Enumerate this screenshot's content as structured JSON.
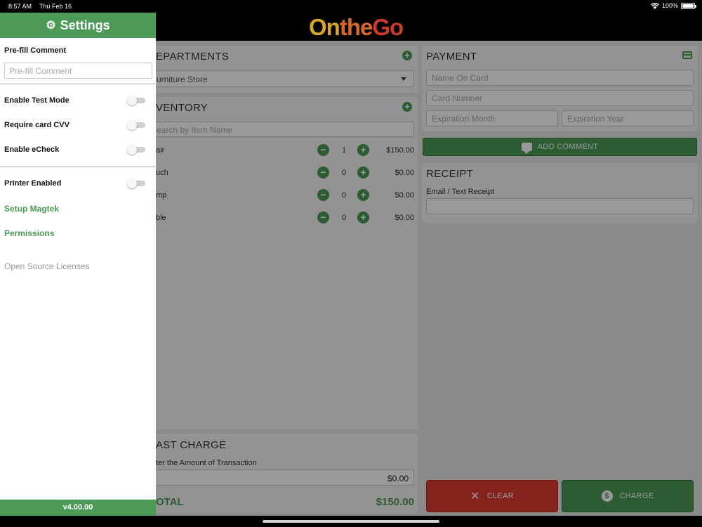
{
  "status_bar": {
    "time": "8:57 AM",
    "date": "Thu Feb 16",
    "battery": "100%"
  },
  "header": {
    "logo_on": "On",
    "logo_the": "the",
    "logo_go": "Go"
  },
  "departments": {
    "title": "EPARTMENTS",
    "selected": "urniture Store"
  },
  "inventory": {
    "title": "VENTORY",
    "search_placeholder": "earch by Item Name",
    "items": [
      {
        "name": "air",
        "qty": "1",
        "price": "$150.00"
      },
      {
        "name": "uch",
        "qty": "0",
        "price": "$0.00"
      },
      {
        "name": "mp",
        "qty": "0",
        "price": "$0.00"
      },
      {
        "name": "ble",
        "qty": "0",
        "price": "$0.00"
      }
    ]
  },
  "fast_charge": {
    "title": "AST CHARGE",
    "label": "ter the Amount of Transaction",
    "amount": "$0.00"
  },
  "total": {
    "label": "OTAL",
    "value": "$150.00"
  },
  "payment": {
    "title": "PAYMENT",
    "name_placeholder": "Name On Card",
    "number_placeholder": "Card Number",
    "exp_month_placeholder": "Expiration Month",
    "exp_year_placeholder": "Expiration Year"
  },
  "add_comment_label": "ADD COMMENT",
  "receipt": {
    "title": "RECEIPT",
    "label": "Email / Text Receipt"
  },
  "actions": {
    "clear": "CLEAR",
    "charge": "CHARGE"
  },
  "settings": {
    "title": "Settings",
    "prefill_label": "Pre-fill Comment",
    "prefill_placeholder": "Pre-fill Comment",
    "test_mode": "Enable Test Mode",
    "require_cvv": "Require card CVV",
    "echeck": "Enable eCheck",
    "printer": "Printer Enabled",
    "setup_magtek": "Setup Magtek",
    "permissions": "Permissions",
    "licenses": "Open Source Licenses",
    "version": "v4.00.00"
  },
  "colors": {
    "accent": "#4c9a55",
    "danger": "#e03a32"
  }
}
